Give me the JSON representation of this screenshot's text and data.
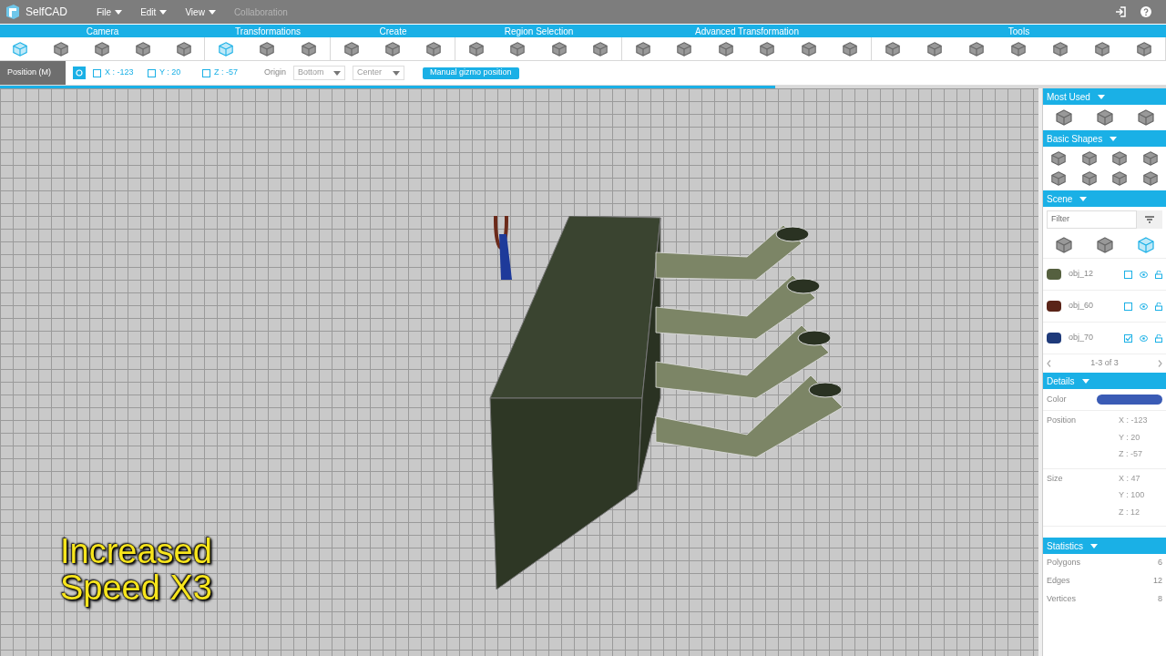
{
  "app": {
    "name": "SelfCAD"
  },
  "menu": [
    {
      "label": "File",
      "disabled": false
    },
    {
      "label": "Edit",
      "disabled": false
    },
    {
      "label": "View",
      "disabled": false
    },
    {
      "label": "Collaboration",
      "disabled": true
    }
  ],
  "toolbar": [
    {
      "title": "Camera",
      "tools": [
        {
          "selected": true
        },
        {
          "selected": false
        },
        {
          "selected": false
        },
        {
          "selected": false
        },
        {
          "selected": false
        }
      ]
    },
    {
      "title": "Transformations",
      "tools": [
        {
          "selected": true
        },
        {
          "selected": false
        },
        {
          "selected": false
        }
      ]
    },
    {
      "title": "Create",
      "tools": [
        {
          "selected": false
        },
        {
          "selected": false
        },
        {
          "selected": false
        }
      ]
    },
    {
      "title": "Region Selection",
      "tools": [
        {
          "selected": false
        },
        {
          "selected": false
        },
        {
          "selected": false
        },
        {
          "selected": false
        }
      ]
    },
    {
      "title": "Advanced Transformation",
      "tools": [
        {
          "selected": false
        },
        {
          "selected": false
        },
        {
          "selected": false
        },
        {
          "selected": false
        },
        {
          "selected": false
        },
        {
          "selected": false
        }
      ]
    },
    {
      "title": "Tools",
      "tools": [
        {
          "selected": false
        },
        {
          "selected": false
        },
        {
          "selected": false
        },
        {
          "selected": false
        },
        {
          "selected": false
        },
        {
          "selected": false
        },
        {
          "selected": false
        }
      ]
    }
  ],
  "position_bar": {
    "label": "Position (M)",
    "coords": [
      {
        "label": "X : -123",
        "checked": false
      },
      {
        "label": "Y : 20",
        "checked": false
      },
      {
        "label": "Z : -57",
        "checked": false
      }
    ],
    "origin_label": "Origin",
    "selects": [
      "Bottom",
      "Center"
    ],
    "button": "Manual gizmo position"
  },
  "progress": {
    "level": 0.665
  },
  "viewport": {
    "caption": [
      "Increased",
      "Speed X3"
    ]
  },
  "panel": {
    "most_used": {
      "title": "Most Used"
    },
    "basic_shapes": {
      "title": "Basic Shapes"
    },
    "scene": {
      "title": "Scene",
      "filter_placeholder": "Filter",
      "views": [
        {
          "selected": false
        },
        {
          "selected": false
        },
        {
          "selected": true
        }
      ],
      "objects": [
        {
          "name": "obj_12",
          "checked": false,
          "color": "#55603f"
        },
        {
          "name": "obj_60",
          "checked": false,
          "color": "#5a2418"
        },
        {
          "name": "obj_70",
          "checked": true,
          "color": "#1e3a7a"
        }
      ],
      "pager": "1-3 of 3"
    },
    "details": {
      "title": "Details",
      "color_label": "Color",
      "color": "#3a5bb5",
      "position_label": "Position",
      "position": [
        "X : -123",
        "Y : 20",
        "Z : -57"
      ],
      "size_label": "Size",
      "size": [
        "X : 47",
        "Y : 100",
        "Z : 12"
      ]
    },
    "statistics": {
      "title": "Statistics",
      "rows": [
        {
          "label": "Polygons",
          "value": "6"
        },
        {
          "label": "Edges",
          "value": "12"
        },
        {
          "label": "Vertices",
          "value": "8"
        }
      ]
    }
  }
}
